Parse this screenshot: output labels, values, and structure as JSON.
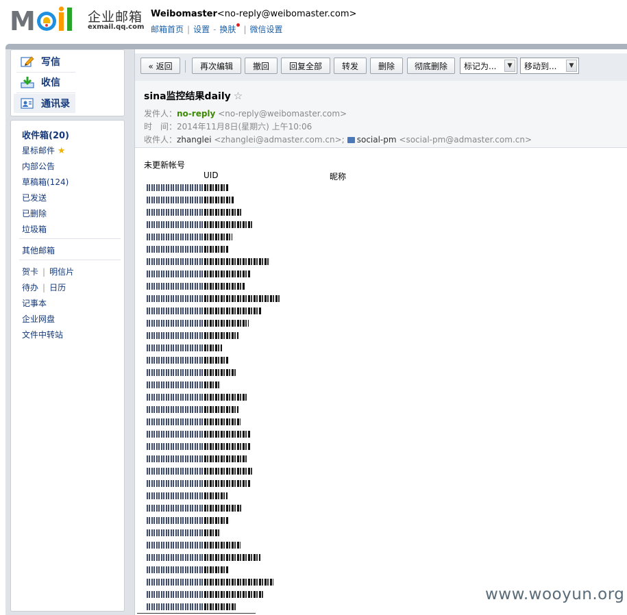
{
  "header": {
    "brand_cn": "企业邮箱",
    "brand_domain": "exmail.qq.com",
    "account_name": "Weibomaster",
    "account_email": "<no-reply@weibomaster.com>",
    "links": [
      "邮箱首页",
      "设置",
      "换肤",
      "微信设置"
    ]
  },
  "sidebar": {
    "quick": [
      {
        "label": "写信",
        "icon": "compose-icon"
      },
      {
        "label": "收信",
        "icon": "receive-icon"
      },
      {
        "label": "通讯录",
        "icon": "contacts-icon"
      }
    ],
    "folders": {
      "inbox": "收件箱(20)",
      "starred": "星标邮件",
      "notice": "内部公告",
      "drafts": "草稿箱(124)",
      "sent": "已发送",
      "deleted": "已删除",
      "spam": "垃圾箱",
      "other": "其他邮箱",
      "card": "贺卡",
      "postcard": "明信片",
      "todo": "待办",
      "calendar": "日历",
      "notes": "记事本",
      "netdisk": "企业网盘",
      "transfer": "文件中转站"
    }
  },
  "toolbar": {
    "back": "« 返回",
    "reedit": "再次编辑",
    "recall": "撤回",
    "reply_all": "回复全部",
    "forward": "转发",
    "delete": "删除",
    "delete_perm": "彻底删除",
    "mark_as": "标记为...",
    "move_to": "移动到..."
  },
  "message": {
    "subject": "sina监控结果daily",
    "from_label": "发件人：",
    "from_name": "no-reply",
    "from_email": "<no-reply@weibomaster.com>",
    "time_label": "时　间：",
    "time_value": "2014年11月8日(星期六) 上午10:06",
    "to_label": "收件人：",
    "to_name1": "zhanglei",
    "to_email1": "<zhanglei@admaster.com.cn>;",
    "to_name2": "social-pm",
    "to_email2": "<social-pm@admaster.com.cn>"
  },
  "body": {
    "title": "未更新帐号",
    "col_uid": "UID",
    "col_nick": "昵称",
    "rows": [
      {
        "uid_w": 0.82,
        "nick_w": 0.3
      },
      {
        "uid_w": 0.82,
        "nick_w": 0.36
      },
      {
        "uid_w": 0.82,
        "nick_w": 0.46
      },
      {
        "uid_w": 0.82,
        "nick_w": 0.58
      },
      {
        "uid_w": 0.82,
        "nick_w": 0.34
      },
      {
        "uid_w": 0.82,
        "nick_w": 0.3
      },
      {
        "uid_w": 0.82,
        "nick_w": 0.8
      },
      {
        "uid_w": 0.82,
        "nick_w": 0.56
      },
      {
        "uid_w": 0.82,
        "nick_w": 0.5
      },
      {
        "uid_w": 0.82,
        "nick_w": 0.92
      },
      {
        "uid_w": 0.82,
        "nick_w": 0.7
      },
      {
        "uid_w": 0.82,
        "nick_w": 0.54
      },
      {
        "uid_w": 0.82,
        "nick_w": 0.42
      },
      {
        "uid_w": 0.82,
        "nick_w": 0.22
      },
      {
        "uid_w": 0.82,
        "nick_w": 0.3
      },
      {
        "uid_w": 0.82,
        "nick_w": 0.38
      },
      {
        "uid_w": 0.82,
        "nick_w": 0.2
      },
      {
        "uid_w": 0.82,
        "nick_w": 0.52
      },
      {
        "uid_w": 0.82,
        "nick_w": 0.42
      },
      {
        "uid_w": 0.82,
        "nick_w": 0.44
      },
      {
        "uid_w": 0.82,
        "nick_w": 0.56
      },
      {
        "uid_w": 0.82,
        "nick_w": 0.56
      },
      {
        "uid_w": 0.82,
        "nick_w": 0.52
      },
      {
        "uid_w": 0.82,
        "nick_w": 0.58
      },
      {
        "uid_w": 0.82,
        "nick_w": 0.56
      },
      {
        "uid_w": 0.82,
        "nick_w": 0.28
      },
      {
        "uid_w": 0.82,
        "nick_w": 0.46
      },
      {
        "uid_w": 0.82,
        "nick_w": 0.3
      },
      {
        "uid_w": 0.82,
        "nick_w": 0.2
      },
      {
        "uid_w": 0.82,
        "nick_w": 0.44
      },
      {
        "uid_w": 0.82,
        "nick_w": 0.68
      },
      {
        "uid_w": 0.82,
        "nick_w": 0.3
      },
      {
        "uid_w": 0.82,
        "nick_w": 0.84
      },
      {
        "uid_w": 0.82,
        "nick_w": 0.72
      },
      {
        "uid_w": 0.82,
        "nick_w": 0.38
      }
    ]
  },
  "watermark": "www.wooyun.org"
}
